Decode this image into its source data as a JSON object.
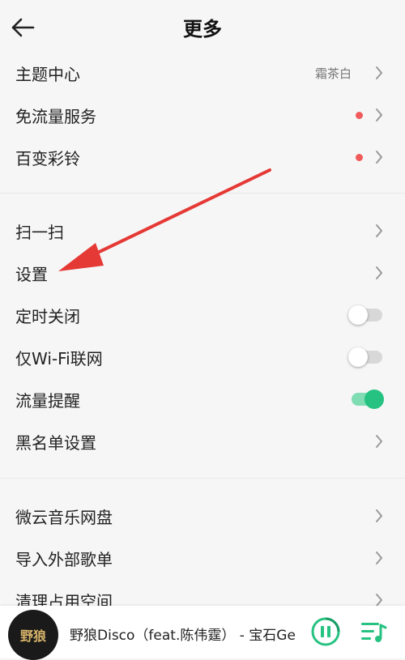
{
  "header": {
    "title": "更多"
  },
  "colors": {
    "accent": "#26c281",
    "dot": "#f05a5a",
    "arrow": "#e53935"
  },
  "rows": [
    {
      "label": "主题中心",
      "value": "霜茶白"
    },
    {
      "label": "免流量服务"
    },
    {
      "label": "百变彩铃"
    },
    {
      "label": "扫一扫"
    },
    {
      "label": "设置"
    },
    {
      "label": "定时关闭",
      "toggle": "off"
    },
    {
      "label": "仅Wi-Fi联网",
      "toggle": "off"
    },
    {
      "label": "流量提醒",
      "toggle": "on"
    },
    {
      "label": "黑名单设置"
    },
    {
      "label": "微云音乐网盘"
    },
    {
      "label": "导入外部歌单"
    },
    {
      "label": "清理占用空间"
    }
  ],
  "player": {
    "album_art_text": "野狼",
    "song": "野狼Disco（feat.陈伟霆） - 宝石Gem"
  }
}
